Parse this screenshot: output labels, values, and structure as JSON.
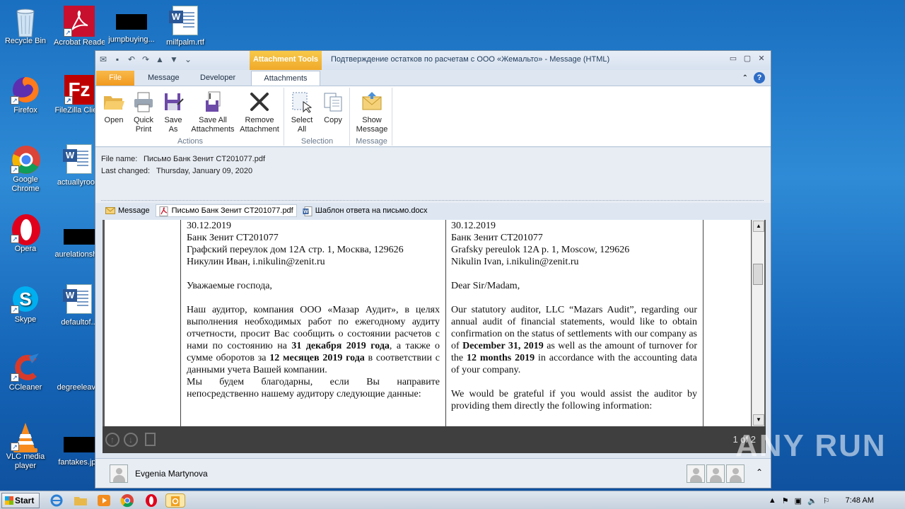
{
  "desktop": {
    "icons": [
      {
        "label": "Recycle Bin"
      },
      {
        "label": "Acrobat Reader DC"
      },
      {
        "label": "jumpbuying..."
      },
      {
        "label": "milfpalm.rtf"
      },
      {
        "label": "Firefox"
      },
      {
        "label": "FileZilla Client"
      },
      {
        "label": "Google Chrome"
      },
      {
        "label": "actuallyroom"
      },
      {
        "label": "Opera"
      },
      {
        "label": "aurelationsh..."
      },
      {
        "label": "Skype"
      },
      {
        "label": "defaultof..."
      },
      {
        "label": "CCleaner"
      },
      {
        "label": "degreeleav..."
      },
      {
        "label": "VLC media player"
      },
      {
        "label": "fantakes.jpg"
      }
    ]
  },
  "window": {
    "context_tab": "Attachment Tools",
    "title": "Подтверждение остатков по расчетам с ООО «Жемальто» - Message (HTML)",
    "tabs": [
      "File",
      "Message",
      "Developer",
      "Attachments"
    ],
    "ribbon": {
      "actions": {
        "label": "Actions",
        "buttons": [
          {
            "label1": "Open",
            "label2": ""
          },
          {
            "label1": "Quick",
            "label2": "Print"
          },
          {
            "label1": "Save",
            "label2": "As"
          },
          {
            "label1": "Save All",
            "label2": "Attachments"
          },
          {
            "label1": "Remove",
            "label2": "Attachment"
          }
        ]
      },
      "selection": {
        "label": "Selection",
        "buttons": [
          {
            "label1": "Select",
            "label2": "All"
          },
          {
            "label1": "Copy",
            "label2": ""
          }
        ]
      },
      "message": {
        "label": "Message",
        "buttons": [
          {
            "label1": "Show",
            "label2": "Message"
          }
        ]
      }
    },
    "info": {
      "file_name_key": "File name:",
      "file_name_value": "Письмо Банк Зенит CT201077.pdf",
      "last_changed_key": "Last changed:",
      "last_changed_value": "Thursday, January 09, 2020"
    },
    "attachments": [
      {
        "label": "Message"
      },
      {
        "label": "Письмо Банк Зенит CT201077.pdf"
      },
      {
        "label": "Шаблон ответа на письмо.docx"
      }
    ],
    "document": {
      "ru": {
        "date": "30.12.2019",
        "line1": "Банк Зенит CT201077",
        "line2": "Графский переулок дом 12А стр. 1, Москва, 129626",
        "line3": "Никулин Иван, i.nikulin@zenit.ru",
        "greeting": "Уважаемые господа,",
        "p1a": "Наш аудитор, компания ООО «Мазар Аудит», в целях выполнения необходимых работ по ежегодному аудиту отчетности, просит Вас сообщить о состоянии расчетов с нами по состоянию на ",
        "p1b": "31 декабря 2019 года",
        "p1c": ", а также о сумме оборотов за ",
        "p1d": "12 месяцев 2019 года",
        "p1e": " в соответствии с данными учета Вашей компании.",
        "p2": "Мы будем благодарны, если Вы направите непосредственно нашему аудитору следующие данные:"
      },
      "en": {
        "date": "30.12.2019",
        "line1": "Банк Зенит CT201077",
        "line2": "Grafsky pereulok 12A p. 1, Moscow, 129626",
        "line3": "Nikulin Ivan, i.nikulin@zenit.ru",
        "greeting": "Dear Sir/Madam,",
        "p1a": "Our statutory auditor, LLC “Mazars Audit”, regarding our annual audit of financial statements, would like to obtain confirmation on the status of settlements with our company as of ",
        "p1b": "December 31, 2019",
        "p1c": " as well as the amount of turnover for the ",
        "p1d": "12 months 2019",
        "p1e": " in accordance with the accounting data of your company.",
        "p2": "We would be grateful if you would assist the auditor by providing them directly the following information:"
      }
    },
    "viewer": {
      "page_count": "1 of 2"
    },
    "people": {
      "name": "Evgenia Martynova"
    }
  },
  "taskbar": {
    "start": "Start",
    "time": "7:48 AM"
  },
  "watermark": "ANY RUN"
}
